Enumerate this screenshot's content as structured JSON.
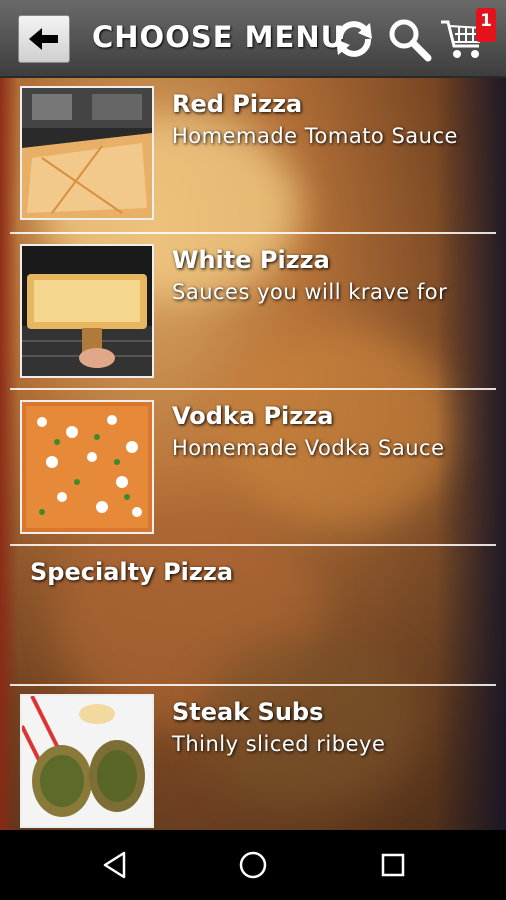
{
  "header": {
    "title": "CHOOSE MENU",
    "cart_count": "1",
    "icons": [
      "back-arrow-icon",
      "refresh-icon",
      "search-icon",
      "cart-icon"
    ]
  },
  "menu": {
    "items": [
      {
        "name": "Red Pizza",
        "description": "Homemade Tomato Sauce",
        "has_image": true
      },
      {
        "name": "White Pizza",
        "description": "Sauces you will krave for",
        "has_image": true
      },
      {
        "name": "Vodka Pizza",
        "description": "Homemade Vodka Sauce",
        "has_image": true
      },
      {
        "name": "Specialty Pizza",
        "description": "",
        "has_image": false
      },
      {
        "name": "Steak Subs",
        "description": "Thinly sliced ribeye",
        "has_image": true
      }
    ]
  },
  "navbar": {
    "icons": [
      "back-triangle-icon",
      "home-circle-icon",
      "recents-square-icon"
    ]
  },
  "colors": {
    "badge": "#e3121b",
    "topbar": "#555555"
  }
}
